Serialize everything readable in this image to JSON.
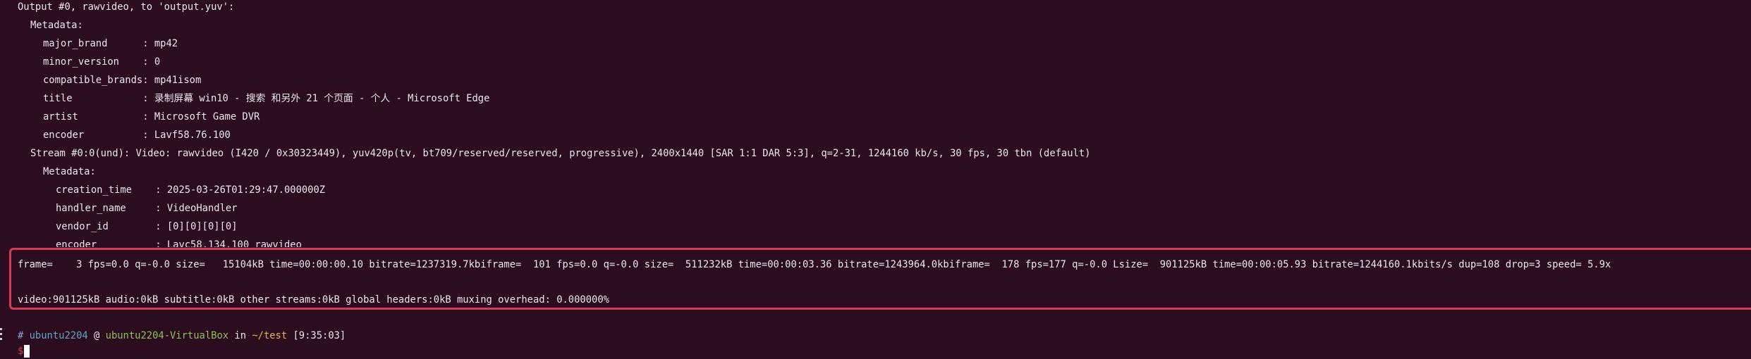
{
  "output": {
    "header": "Output #0, rawvideo, to 'output.yuv':",
    "metadata_label": "Metadata:",
    "metadata": [
      {
        "key": "major_brand     ",
        "value": ": mp42"
      },
      {
        "key": "minor_version   ",
        "value": ": 0"
      },
      {
        "key": "compatible_brands",
        "value": ": mp41isom"
      },
      {
        "key": "title           ",
        "value": ": 录制屏幕 win10 - 搜索 和另外 21 个页面 - 个人 - Microsoft Edge"
      },
      {
        "key": "artist          ",
        "value": ": Microsoft Game DVR"
      },
      {
        "key": "encoder         ",
        "value": ": Lavf58.76.100"
      }
    ],
    "stream_line": "Stream #0:0(und): Video: rawvideo (I420 / 0x30323449), yuv420p(tv, bt709/reserved/reserved, progressive), 2400x1440 [SAR 1:1 DAR 5:3], q=2-31, 1244160 kb/s, 30 fps, 30 tbn (default)",
    "stream_metadata_label": "Metadata:",
    "stream_metadata": [
      {
        "key": "creation_time   ",
        "value": ": 2025-03-26T01:29:47.000000Z"
      },
      {
        "key": "handler_name    ",
        "value": ": VideoHandler"
      },
      {
        "key": "vendor_id       ",
        "value": ": [0][0][0][0]"
      },
      {
        "key": "encoder         ",
        "value": ": Lavc58.134.100 rawvideo"
      }
    ]
  },
  "progress": {
    "text": "frame=    3 fps=0.0 q=-0.0 size=   15104kB time=00:00:00.10 bitrate=1237319.7kbiframe=  101 fps=0.0 q=-0.0 size=  511232kB time=00:00:03.36 bitrate=1243964.0kbiframe=  178 fps=177 q=-0.0 Lsize=  901125kB time=00:00:05.93 bitrate=1244160.1kbits/s dup=108 drop=3 speed= 5.9x",
    "summary": "video:901125kB audio:0kB subtitle:0kB other streams:0kB global headers:0kB muxing overhead: 0.000000%"
  },
  "prompt": {
    "hash": "#",
    "user": "ubuntu2204",
    "at": "@",
    "host": "ubuntu2204-VirtualBox",
    "in": "in",
    "dir": "~/test",
    "time": "[9:35:03]",
    "dollar": "$"
  },
  "colors": {
    "background": "#2c0c1f",
    "highlight_border": "#d23c54",
    "user": "#5fa8c8",
    "host": "#8bc25a",
    "dir": "#e6b35a"
  }
}
